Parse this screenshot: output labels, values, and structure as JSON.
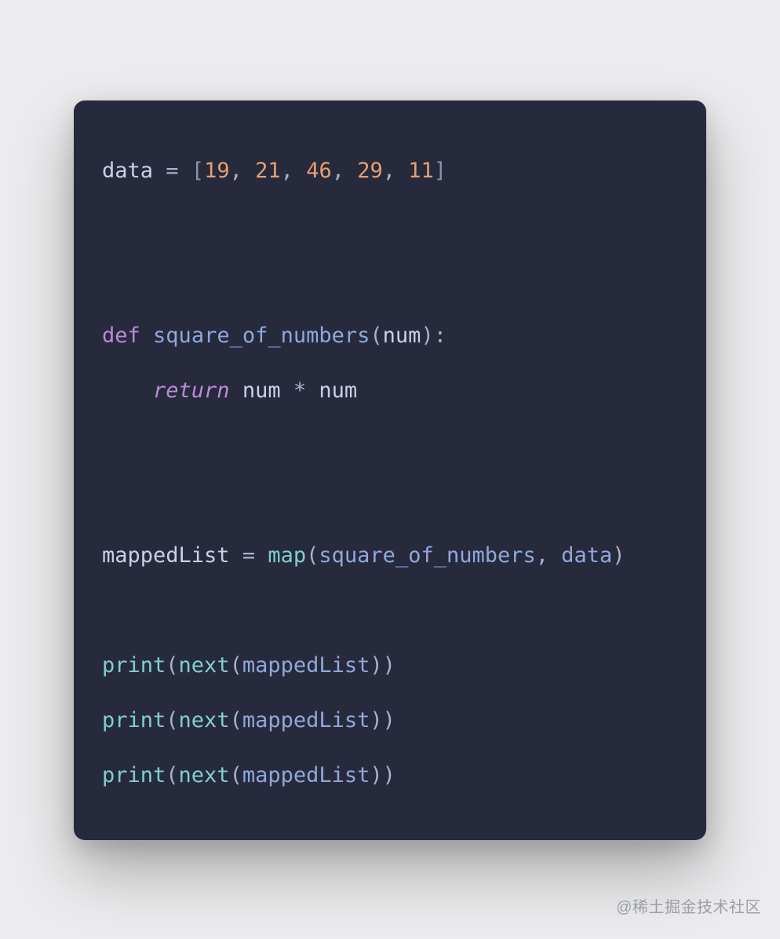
{
  "code": {
    "lines": [
      [
        {
          "t": "data",
          "c": "tok-var"
        },
        {
          "t": " ",
          "c": ""
        },
        {
          "t": "=",
          "c": "tok-op"
        },
        {
          "t": " ",
          "c": ""
        },
        {
          "t": "[",
          "c": "tok-br"
        },
        {
          "t": "19",
          "c": "tok-num"
        },
        {
          "t": ",",
          "c": "tok-punc"
        },
        {
          "t": " ",
          "c": ""
        },
        {
          "t": "21",
          "c": "tok-num"
        },
        {
          "t": ",",
          "c": "tok-punc"
        },
        {
          "t": " ",
          "c": ""
        },
        {
          "t": "46",
          "c": "tok-num"
        },
        {
          "t": ",",
          "c": "tok-punc"
        },
        {
          "t": " ",
          "c": ""
        },
        {
          "t": "29",
          "c": "tok-num"
        },
        {
          "t": ",",
          "c": "tok-punc"
        },
        {
          "t": " ",
          "c": ""
        },
        {
          "t": "11",
          "c": "tok-num"
        },
        {
          "t": "]",
          "c": "tok-br"
        }
      ],
      [],
      [],
      [
        {
          "t": "def",
          "c": "tok-kw"
        },
        {
          "t": " ",
          "c": ""
        },
        {
          "t": "square_of_numbers",
          "c": "tok-fn"
        },
        {
          "t": "(",
          "c": "tok-punc"
        },
        {
          "t": "num",
          "c": "tok-param"
        },
        {
          "t": ")",
          "c": "tok-punc"
        },
        {
          "t": ":",
          "c": "tok-punc"
        }
      ],
      [
        {
          "t": "    ",
          "c": ""
        },
        {
          "t": "return",
          "c": "tok-ret"
        },
        {
          "t": " ",
          "c": ""
        },
        {
          "t": "num",
          "c": "tok-var"
        },
        {
          "t": " ",
          "c": ""
        },
        {
          "t": "*",
          "c": "tok-op"
        },
        {
          "t": " ",
          "c": ""
        },
        {
          "t": "num",
          "c": "tok-var"
        }
      ],
      [],
      [],
      [
        {
          "t": "mappedList",
          "c": "tok-var"
        },
        {
          "t": " ",
          "c": ""
        },
        {
          "t": "=",
          "c": "tok-op"
        },
        {
          "t": " ",
          "c": ""
        },
        {
          "t": "map",
          "c": "tok-call"
        },
        {
          "t": "(",
          "c": "tok-punc"
        },
        {
          "t": "square_of_numbers",
          "c": "tok-ident"
        },
        {
          "t": ",",
          "c": "tok-punc"
        },
        {
          "t": " ",
          "c": ""
        },
        {
          "t": "data",
          "c": "tok-ident"
        },
        {
          "t": ")",
          "c": "tok-punc"
        }
      ],
      [],
      [
        {
          "t": "print",
          "c": "tok-call"
        },
        {
          "t": "(",
          "c": "tok-punc"
        },
        {
          "t": "next",
          "c": "tok-call"
        },
        {
          "t": "(",
          "c": "tok-punc"
        },
        {
          "t": "mappedList",
          "c": "tok-ident"
        },
        {
          "t": ")",
          "c": "tok-punc"
        },
        {
          "t": ")",
          "c": "tok-punc"
        }
      ],
      [
        {
          "t": "print",
          "c": "tok-call"
        },
        {
          "t": "(",
          "c": "tok-punc"
        },
        {
          "t": "next",
          "c": "tok-call"
        },
        {
          "t": "(",
          "c": "tok-punc"
        },
        {
          "t": "mappedList",
          "c": "tok-ident"
        },
        {
          "t": ")",
          "c": "tok-punc"
        },
        {
          "t": ")",
          "c": "tok-punc"
        }
      ],
      [
        {
          "t": "print",
          "c": "tok-call"
        },
        {
          "t": "(",
          "c": "tok-punc"
        },
        {
          "t": "next",
          "c": "tok-call"
        },
        {
          "t": "(",
          "c": "tok-punc"
        },
        {
          "t": "mappedList",
          "c": "tok-ident"
        },
        {
          "t": ")",
          "c": "tok-punc"
        },
        {
          "t": ")",
          "c": "tok-punc"
        }
      ]
    ]
  },
  "watermark": "@稀土掘金技术社区",
  "colors": {
    "background": "#ececee",
    "card": "#272a3d",
    "text_default": "#c9d1e8",
    "number": "#e79e70",
    "keyword": "#ba8ad6",
    "function": "#8fa8d9",
    "builtin": "#7fcfd2"
  }
}
